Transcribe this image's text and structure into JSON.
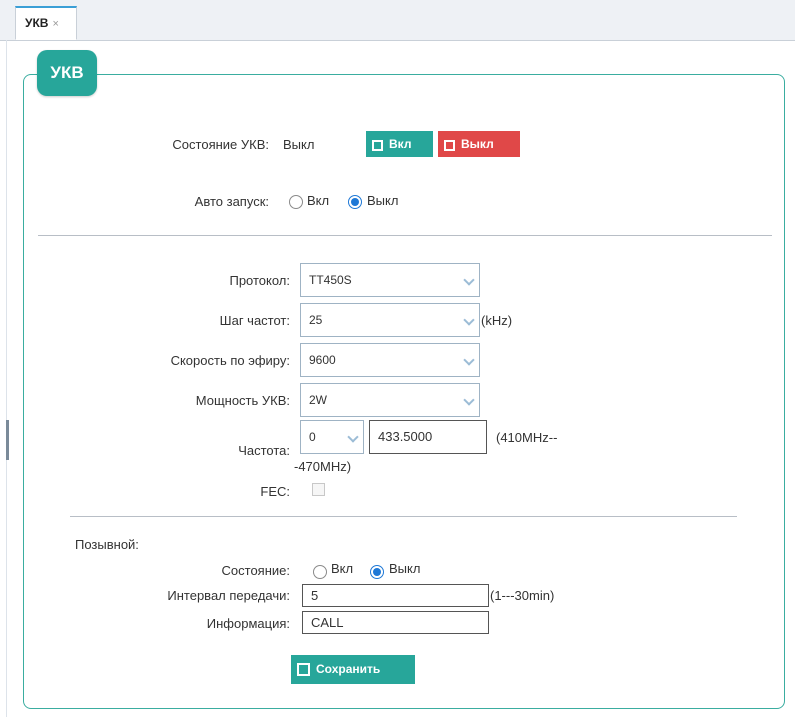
{
  "tab": {
    "label": "УКВ",
    "close": "×"
  },
  "panel": {
    "title": "УКВ"
  },
  "status": {
    "label": "Состояние УКВ:",
    "value": "Выкл",
    "btn_on": "Вкл",
    "btn_off": "Выкл"
  },
  "autostart": {
    "label": "Авто запуск:",
    "opt_on": "Вкл",
    "opt_off": "Выкл",
    "selected": "Выкл"
  },
  "protocol": {
    "label": "Протокол:",
    "value": "TT450S"
  },
  "step": {
    "label": "Шаг частот:",
    "value": "25",
    "unit": "(kHz)"
  },
  "airspeed": {
    "label": "Скорость по эфиру:",
    "value": "9600"
  },
  "power": {
    "label": "Мощность УКВ:",
    "value": "2W"
  },
  "frequency": {
    "label": "Частота:",
    "channel": "0",
    "value": "433.5000",
    "range_a": "(410MHz--",
    "range_b": "-470MHz)"
  },
  "fec": {
    "label": "FEC:",
    "checked": false
  },
  "callsign": {
    "section_label": "Позывной:",
    "state_label": "Состояние:",
    "opt_on": "Вкл",
    "opt_off": "Выкл",
    "selected": "Выкл",
    "interval_label": "Интервал передачи:",
    "interval_value": "5",
    "interval_unit": "(1---30min)",
    "info_label": "Информация:",
    "info_value": "CALL"
  },
  "save": {
    "label": "Сохранить"
  },
  "colors": {
    "accent": "#27a69a",
    "danger": "#e04848",
    "radio_selected": "#1e78d6"
  }
}
